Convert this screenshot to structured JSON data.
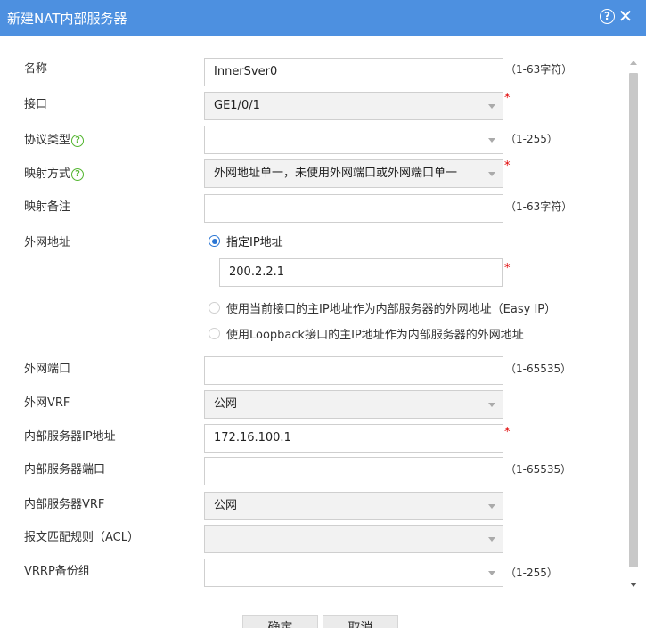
{
  "dialog": {
    "title": "新建NAT内部服务器",
    "help_glyph": "?",
    "close_glyph": "✕",
    "accent_color": "#4d90e0"
  },
  "form": {
    "name": {
      "label": "名称",
      "value": "InnerSver0",
      "range": "（1-63字符）"
    },
    "interface": {
      "label": "接口",
      "value": "GE1/0/1",
      "required": "*"
    },
    "protocol": {
      "label": "协议类型",
      "value": "",
      "range": "（1-255）"
    },
    "mapping_mode": {
      "label": "映射方式",
      "value": "外网地址单一，未使用外网端口或外网端口单一",
      "required": "*"
    },
    "mapping_note": {
      "label": "映射备注",
      "value": "",
      "range": "（1-63字符）"
    },
    "public_address": {
      "label": "外网地址",
      "options": [
        {
          "label": "指定IP地址",
          "selected": true
        },
        {
          "label": "使用当前接口的主IP地址作为内部服务器的外网地址（Easy IP）",
          "selected": false
        },
        {
          "label": "使用Loopback接口的主IP地址作为内部服务器的外网地址",
          "selected": false
        }
      ],
      "ip_value": "200.2.2.1",
      "required": "*"
    },
    "public_port": {
      "label": "外网端口",
      "value": "",
      "range": "（1-65535）"
    },
    "public_vrf": {
      "label": "外网VRF",
      "value": "公网"
    },
    "internal_ip": {
      "label": "内部服务器IP地址",
      "value": "172.16.100.1",
      "required": "*"
    },
    "internal_port": {
      "label": "内部服务器端口",
      "value": "",
      "range": "（1-65535）"
    },
    "internal_vrf": {
      "label": "内部服务器VRF",
      "value": "公网"
    },
    "acl": {
      "label": "报文匹配规则（ACL）",
      "value": ""
    },
    "vrrp": {
      "label": "VRRP备份组",
      "value": "",
      "range": "（1-255）"
    }
  },
  "buttons": {
    "ok": "确定",
    "cancel": "取消"
  }
}
